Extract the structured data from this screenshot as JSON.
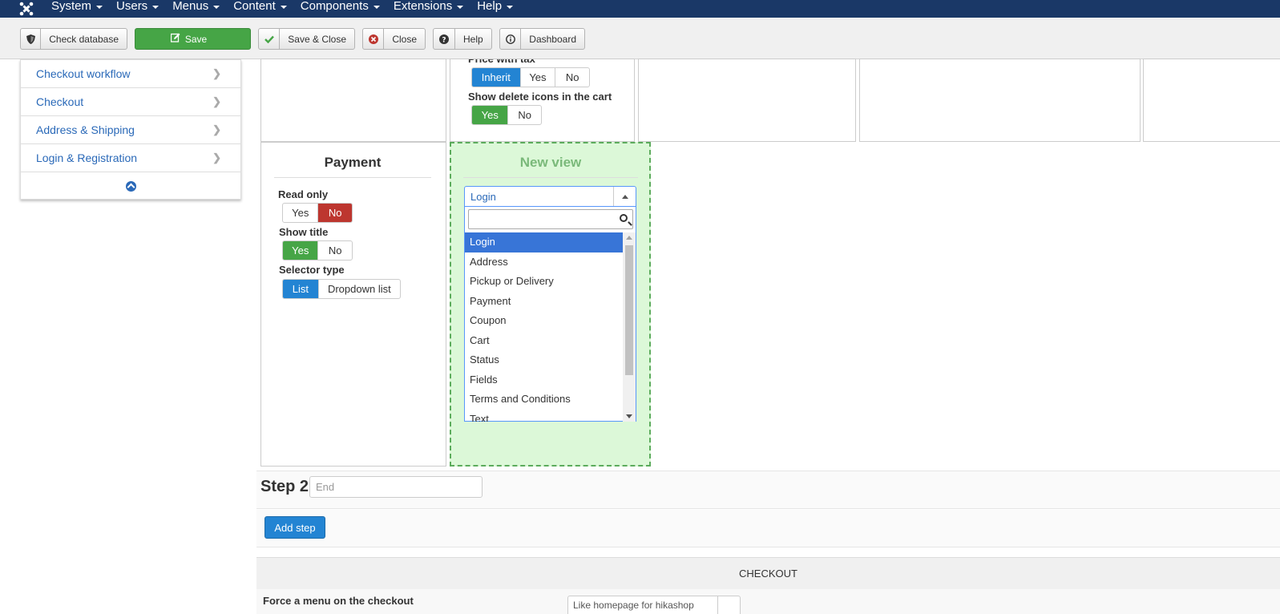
{
  "nav": {
    "items": [
      "System",
      "Users",
      "Menus",
      "Content",
      "Components",
      "Extensions",
      "Help"
    ]
  },
  "toolbar": {
    "check_database": "Check database",
    "save": "Save",
    "save_close": "Save & Close",
    "close": "Close",
    "help": "Help",
    "dashboard": "Dashboard"
  },
  "sidebar": {
    "items": [
      "Checkout workflow",
      "Checkout",
      "Address & Shipping",
      "Login & Registration"
    ]
  },
  "cart_cell": {
    "price_with_tax_label": "Price with tax",
    "price_with_tax_options": [
      "Inherit",
      "Yes",
      "No"
    ],
    "price_with_tax_selected": "Inherit",
    "show_delete_label": "Show delete icons in the cart",
    "show_delete_options": [
      "Yes",
      "No"
    ],
    "show_delete_selected": "Yes"
  },
  "payment_cell": {
    "title": "Payment",
    "read_only_label": "Read only",
    "read_only_options": [
      "Yes",
      "No"
    ],
    "read_only_selected": "No",
    "show_title_label": "Show title",
    "show_title_options": [
      "Yes",
      "No"
    ],
    "show_title_selected": "Yes",
    "selector_type_label": "Selector type",
    "selector_type_options": [
      "List",
      "Dropdown list"
    ],
    "selector_type_selected": "List"
  },
  "new_view": {
    "title": "New view",
    "selected": "Login",
    "search_value": "",
    "options": [
      "Login",
      "Address",
      "Pickup or Delivery",
      "Payment",
      "Coupon",
      "Cart",
      "Status",
      "Fields",
      "Terms and Conditions",
      "Text"
    ]
  },
  "step2": {
    "label": "Step 2",
    "placeholder": "End"
  },
  "add_step": "Add step",
  "checkout_section": {
    "title": "CHECKOUT",
    "force_menu_label": "Force a menu on the checkout",
    "force_menu_value": "Like homepage for hikashop"
  },
  "colors": {
    "navbar": "#1a3867",
    "save_green": "#46a546",
    "primary_blue": "#2384d3",
    "danger_red": "#bd362f",
    "new_view_bg": "#dcf8d8",
    "link_blue": "#2a69b8"
  }
}
